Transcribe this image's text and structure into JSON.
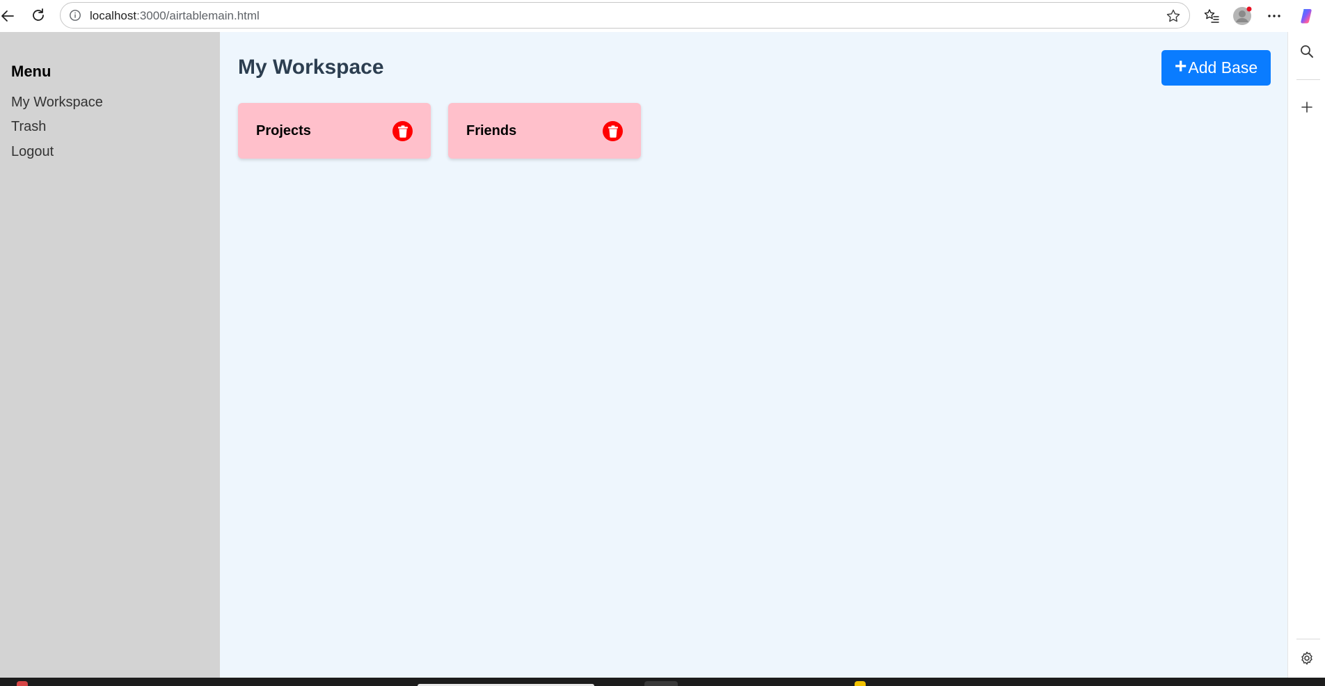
{
  "browser": {
    "url_host": "localhost",
    "url_path": ":3000/airtablemain.html",
    "icons": [
      "back-icon",
      "reload-icon",
      "info-icon",
      "star-icon",
      "favorites-icon",
      "profile-icon",
      "more-icon",
      "copilot-icon",
      "search-icon",
      "plus-icon",
      "settings-icon"
    ]
  },
  "sidebar": {
    "heading": "Menu",
    "items": [
      {
        "label": "My Workspace"
      },
      {
        "label": "Trash"
      },
      {
        "label": "Logout"
      }
    ]
  },
  "main": {
    "title": "My Workspace",
    "add_button": {
      "icon": "+",
      "label": "Add Base"
    },
    "bases": [
      {
        "name": "Projects"
      },
      {
        "name": "Friends"
      }
    ]
  },
  "colors": {
    "sidebar_bg": "#d3d3d3",
    "main_bg": "#eef6fd",
    "accent": "#0a7cff",
    "card_bg": "#ffc0cb",
    "delete": "#ff0000",
    "title": "#2c3e50"
  }
}
